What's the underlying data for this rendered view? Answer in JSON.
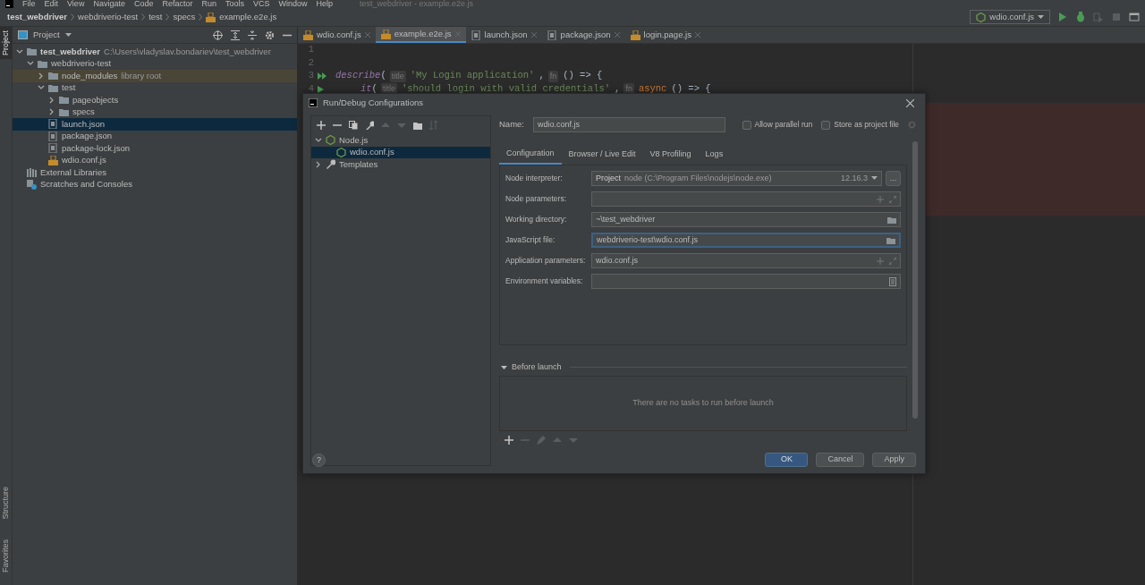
{
  "menu": [
    "File",
    "Edit",
    "View",
    "Navigate",
    "Code",
    "Refactor",
    "Run",
    "Tools",
    "VCS",
    "Window",
    "Help"
  ],
  "window_title": "test_webdriver - example.e2e.js",
  "breadcrumbs": [
    {
      "label": "test_webdriver",
      "kind": "folder"
    },
    {
      "label": "webdriverio-test",
      "kind": "folder"
    },
    {
      "label": "test",
      "kind": "folder"
    },
    {
      "label": "specs",
      "kind": "folder"
    },
    {
      "label": "example.e2e.js",
      "kind": "file"
    }
  ],
  "run_toolbar": {
    "config": "wdio.conf.js",
    "buttons": [
      {
        "kind": "run",
        "disabled": false
      },
      {
        "kind": "debug",
        "disabled": false
      },
      {
        "kind": "coverage",
        "disabled": true
      },
      {
        "kind": "stop",
        "disabled": true
      },
      {
        "kind": "terminal",
        "disabled": false
      }
    ]
  },
  "tool_windows_top": [
    {
      "label": "Project",
      "selected": true
    }
  ],
  "tool_windows_bottom": [
    {
      "label": "Structure",
      "selected": false
    },
    {
      "label": "Favorites",
      "selected": false
    }
  ],
  "project_panel": {
    "title": "Project",
    "tree": [
      {
        "label": "test_webdriver",
        "hint": "C:\\Users\\vladyslav.bondariev\\test_webdriver",
        "kind": "project_root",
        "expanded": true,
        "selected": false,
        "children": [
          {
            "label": "webdriverio-test",
            "kind": "folder",
            "expanded": true,
            "selected": false,
            "children": [
              {
                "label": "node_modules",
                "hint": "library root",
                "kind": "library_folder",
                "expanded": false,
                "selected": false
              },
              {
                "label": "test",
                "kind": "folder",
                "expanded": true,
                "selected": false,
                "children": [
                  {
                    "label": "pageobjects",
                    "kind": "folder",
                    "expanded": false,
                    "selected": false
                  },
                  {
                    "label": "specs",
                    "kind": "folder",
                    "expanded": false,
                    "selected": false
                  }
                ]
              },
              {
                "label": "launch.json",
                "kind": "json_file",
                "selected": true
              },
              {
                "label": "package.json",
                "kind": "json_file",
                "selected": false
              },
              {
                "label": "package-lock.json",
                "kind": "json_file",
                "selected": false
              },
              {
                "label": "wdio.conf.js",
                "kind": "js_file",
                "selected": false
              }
            ]
          }
        ]
      },
      {
        "label": "External Libraries",
        "kind": "libraries",
        "selected": false
      },
      {
        "label": "Scratches and Consoles",
        "kind": "scratches",
        "selected": false
      }
    ]
  },
  "editor_tabs": [
    {
      "label": "wdio.conf.js",
      "kind": "js_file",
      "selected": false
    },
    {
      "label": "example.e2e.js",
      "kind": "js_file",
      "selected": true
    },
    {
      "label": "launch.json",
      "kind": "json_file",
      "selected": false
    },
    {
      "label": "package.json",
      "kind": "json_file",
      "selected": false
    },
    {
      "label": "login.page.js",
      "kind": "js_file",
      "selected": false
    }
  ],
  "code_lines": [
    {
      "number": "1",
      "kind": "blank"
    },
    {
      "number": "2",
      "kind": "blank"
    },
    {
      "number": "3",
      "kind": "suite",
      "tokens": [
        {
          "kind": "function",
          "text": "describe"
        },
        {
          "kind": "plain",
          "text": "("
        },
        {
          "kind": "hint",
          "text": "title"
        },
        {
          "kind": "string",
          "text": "'My Login application'"
        },
        {
          "kind": "plain",
          "text": ","
        },
        {
          "kind": "hint",
          "text": "fn"
        },
        {
          "kind": "plain",
          "text": "() => {"
        }
      ],
      "children": [
        {
          "number": "4",
          "kind": "test",
          "tokens": [
            {
              "kind": "function",
              "text": "it"
            },
            {
              "kind": "plain",
              "text": "("
            },
            {
              "kind": "hint",
              "text": "title"
            },
            {
              "kind": "string",
              "text": "'should login with valid credentials'"
            },
            {
              "kind": "plain",
              "text": ","
            },
            {
              "kind": "hint",
              "text": "fn"
            },
            {
              "kind": "keyword",
              "text": "async"
            },
            {
              "kind": "plain",
              "text": "() => {"
            }
          ]
        }
      ]
    }
  ],
  "dialog": {
    "title": "Run/Debug Configurations",
    "toolbar": [
      {
        "kind": "add",
        "disabled": false
      },
      {
        "kind": "remove",
        "disabled": false
      },
      {
        "kind": "copy",
        "disabled": false
      },
      {
        "kind": "wrench",
        "disabled": false
      },
      {
        "kind": "up",
        "disabled": true
      },
      {
        "kind": "down",
        "disabled": true
      },
      {
        "kind": "folder",
        "disabled": false
      },
      {
        "kind": "sort",
        "disabled": true
      }
    ],
    "tree": [
      {
        "label": "Node.js",
        "kind": "node_config",
        "expanded": true,
        "selected": false,
        "children": [
          {
            "label": "wdio.conf.js",
            "kind": "node_config",
            "selected": true
          }
        ]
      },
      {
        "label": "Templates",
        "kind": "templates",
        "expanded": false,
        "selected": false
      }
    ],
    "name_label": "Name:",
    "name_value": "wdio.conf.js",
    "checkboxes": [
      {
        "label": "Allow parallel run",
        "checked": false
      },
      {
        "label": "Store as project file",
        "checked": false
      }
    ],
    "tabs": [
      {
        "label": "Configuration",
        "selected": true
      },
      {
        "label": "Browser / Live Edit",
        "selected": false
      },
      {
        "label": "V8 Profiling",
        "selected": false
      },
      {
        "label": "Logs",
        "selected": false
      }
    ],
    "fields": [
      {
        "label": "Node interpreter:",
        "kind": "interpreter",
        "prefix": "Project",
        "value": "node (C:\\Program Files\\nodejs\\node.exe)",
        "version": "12.16.3",
        "browse": "...",
        "focused": false
      },
      {
        "label": "Node parameters:",
        "kind": "expandable",
        "focused": false
      },
      {
        "label": "Working directory:",
        "kind": "folder",
        "value": "~\\test_webdriver",
        "focused": false
      },
      {
        "label": "JavaScript file:",
        "kind": "folder",
        "value": "webdriverio-test\\wdio.conf.js",
        "focused": true
      },
      {
        "label": "Application parameters:",
        "kind": "expandable",
        "value": "wdio.conf.js",
        "focused": false
      },
      {
        "label": "Environment variables:",
        "kind": "list",
        "focused": false
      }
    ],
    "before_launch": {
      "title": "Before launch",
      "expanded": true,
      "empty_text": "There are no tasks to run before launch",
      "toolbar": [
        {
          "kind": "add",
          "disabled": false
        },
        {
          "kind": "remove",
          "disabled": true
        },
        {
          "kind": "edit",
          "disabled": true
        },
        {
          "kind": "up",
          "disabled": true
        },
        {
          "kind": "down",
          "disabled": true
        }
      ]
    },
    "help": "?",
    "buttons": [
      {
        "label": "OK",
        "kind": "primary"
      },
      {
        "label": "Cancel",
        "kind": "default"
      },
      {
        "label": "Apply",
        "kind": "default"
      }
    ]
  }
}
